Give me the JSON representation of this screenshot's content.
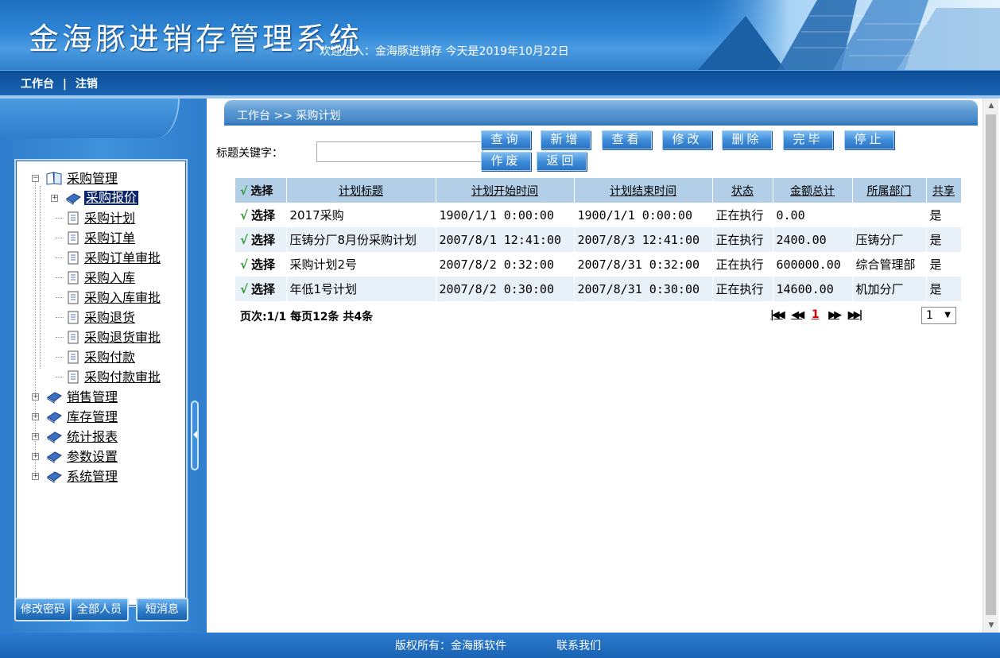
{
  "header": {
    "app_title": "金海豚进销存管理系统",
    "welcome": "欢迎进入：金海豚进销存 今天是2019年10月22日"
  },
  "toolbar": {
    "workbench": "工作台",
    "separator": "|",
    "logout": "注销"
  },
  "sidebar": {
    "tree": [
      {
        "label": "采购管理",
        "expanded": true,
        "children": [
          "采购报价",
          "采购计划",
          "采购订单",
          "采购订单审批",
          "采购入库",
          "采购入库审批",
          "采购退货",
          "采购退货审批",
          "采购付款",
          "采购付款审批"
        ]
      },
      {
        "label": "销售管理"
      },
      {
        "label": "库存管理"
      },
      {
        "label": "统计报表"
      },
      {
        "label": "参数设置"
      },
      {
        "label": "系统管理"
      }
    ],
    "selected": "采购报价",
    "buttons": {
      "change_password": "修改密码",
      "all_staff": "全部人员",
      "messages": "短消息"
    }
  },
  "main": {
    "breadcrumb": "工作台 >> 采购计划",
    "search_label": "标题关键字：",
    "search_value": "",
    "actions": [
      "查询",
      "新增",
      "查看",
      "修改",
      "删除",
      "完毕",
      "停止",
      "作废",
      "返回"
    ],
    "grid": {
      "columns": [
        "选择",
        "计划标题",
        "计划开始时间",
        "计划结束时间",
        "状态",
        "金额总计",
        "所属部门",
        "共享"
      ],
      "rows": [
        [
          "选择",
          "2017采购",
          "1900/1/1 0:00:00",
          "1900/1/1 0:00:00",
          "正在执行",
          "0.00",
          "",
          "是"
        ],
        [
          "选择",
          "压铸分厂8月份采购计划",
          "2007/8/1 12:41:00",
          "2007/8/3 12:41:00",
          "正在执行",
          "2400.00",
          "压铸分厂",
          "是"
        ],
        [
          "选择",
          "采购计划2号",
          "2007/8/2 0:32:00",
          "2007/8/31 0:32:00",
          "正在执行",
          "600000.00",
          "综合管理部",
          "是"
        ],
        [
          "选择",
          "年低1号计划",
          "2007/8/2 0:30:00",
          "2007/8/31 0:30:00",
          "正在执行",
          "14600.00",
          "机加分厂",
          "是"
        ]
      ]
    },
    "pager": {
      "info": "页次:1/1 每页12条 共4条",
      "current": "1",
      "select_value": "1"
    }
  },
  "footer": {
    "copyright": "版权所有：金海豚软件",
    "contact": "联系我们"
  }
}
